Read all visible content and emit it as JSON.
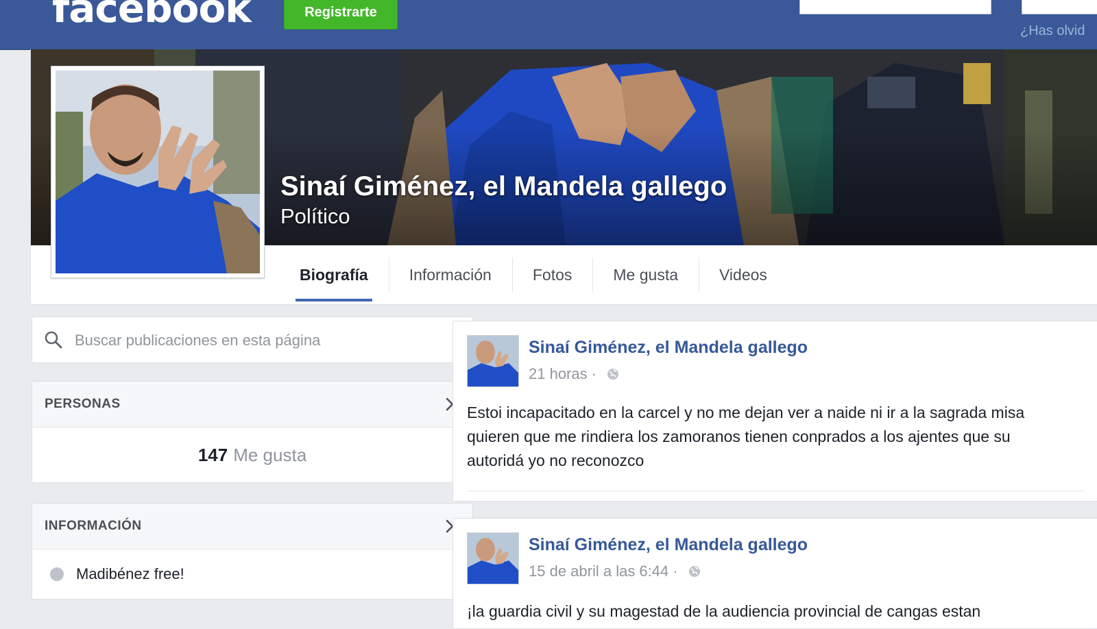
{
  "header": {
    "logo_text": "facebook",
    "register_label": "Registrarte",
    "forgot_label": "¿Has olvid"
  },
  "page": {
    "name": "Sinaí Giménez, el Mandela gallego",
    "category": "Político"
  },
  "tabs": [
    {
      "label": "Biografía",
      "active": true
    },
    {
      "label": "Información",
      "active": false
    },
    {
      "label": "Fotos",
      "active": false
    },
    {
      "label": "Me gusta",
      "active": false
    },
    {
      "label": "Videos",
      "active": false
    }
  ],
  "search": {
    "placeholder": "Buscar publicaciones en esta página"
  },
  "people": {
    "title": "PERSONAS",
    "likes_count": "147",
    "likes_label": "Me gusta"
  },
  "info": {
    "title": "INFORMACIÓN",
    "item": "Madibénez free!"
  },
  "posts": [
    {
      "author": "Sinaí Giménez, el Mandela gallego",
      "time": "21 horas ·",
      "text": "Estoi incapacitado en la carcel y no me dejan ver a naide ni ir a la sagrada misa quieren que me rindiera los zamoranos tienen conprados a los ajentes que su autoridá yo no reconozco"
    },
    {
      "author": "Sinaí Giménez, el Mandela gallego",
      "time": "15 de abril a las 6:44 ·",
      "text": "¡la guardia civil y su magestad de la audiencia provincial de cangas estan"
    }
  ],
  "colors": {
    "brand_blue": "#3b5998",
    "register_green": "#42b72a",
    "link_blue": "#365899",
    "tab_underline": "#4267b2"
  },
  "icons": {
    "search": "search-icon",
    "chevron": "chevron-right-icon",
    "globe": "globe-icon",
    "info": "info-icon"
  }
}
